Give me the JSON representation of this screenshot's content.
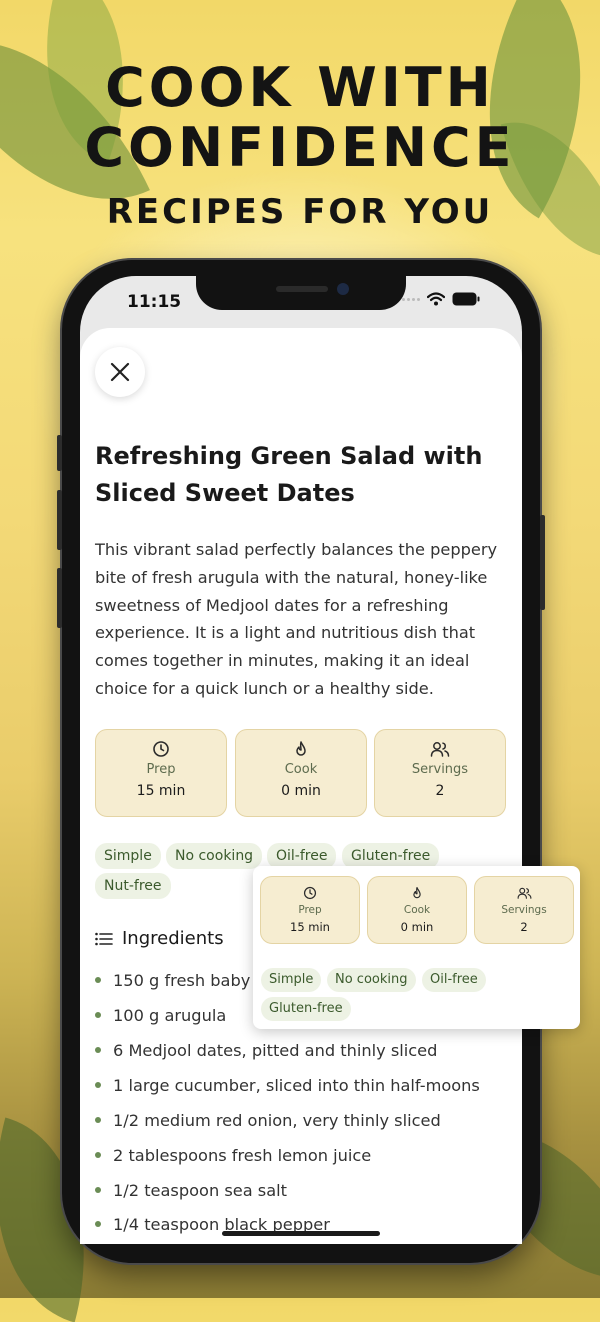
{
  "headline": {
    "line1": "COOK WITH",
    "line2": "CONFIDENCE",
    "line3": "RECIPES FOR YOU"
  },
  "status_bar": {
    "time": "11:15",
    "icons": [
      "wifi-icon",
      "battery-icon"
    ]
  },
  "recipe": {
    "title": "Refreshing Green Salad with Sliced Sweet Dates",
    "description": "This vibrant salad perfectly balances the peppery bite of fresh arugula with the natural, honey-like sweetness of Medjool dates for a refreshing experience. It is a light and nutritious dish that comes together in minutes, making it an ideal choice for a quick lunch or a healthy side.",
    "stats": [
      {
        "icon": "clock-icon",
        "label": "Prep",
        "value": "15 min"
      },
      {
        "icon": "flame-icon",
        "label": "Cook",
        "value": "0 min"
      },
      {
        "icon": "people-icon",
        "label": "Servings",
        "value": "2"
      }
    ],
    "tags": [
      "Simple",
      "No cooking",
      "Oil-free",
      "Gluten-free",
      "Nut-free"
    ],
    "ingredients_heading": "Ingredients",
    "ingredients": [
      "150 g fresh baby s",
      "100 g arugula",
      "6 Medjool dates, pitted and thinly sliced",
      "1 large cucumber, sliced into thin half-moons",
      "1/2 medium red onion, very thinly sliced",
      "2 tablespoons fresh lemon juice",
      "1/2 teaspoon sea salt",
      "1/4 teaspoon black pepper"
    ]
  },
  "popup": {
    "stats": [
      {
        "icon": "clock-icon",
        "label": "Prep",
        "value": "15 min"
      },
      {
        "icon": "flame-icon",
        "label": "Cook",
        "value": "0 min"
      },
      {
        "icon": "people-icon",
        "label": "Servings",
        "value": "2"
      }
    ],
    "tags": [
      "Simple",
      "No cooking",
      "Oil-free",
      "Gluten-free"
    ]
  },
  "colors": {
    "accent_card": "#f6edd1",
    "tag_bg": "#edf2e4",
    "tag_text": "#3b5a2c",
    "background": "#f2d868"
  }
}
